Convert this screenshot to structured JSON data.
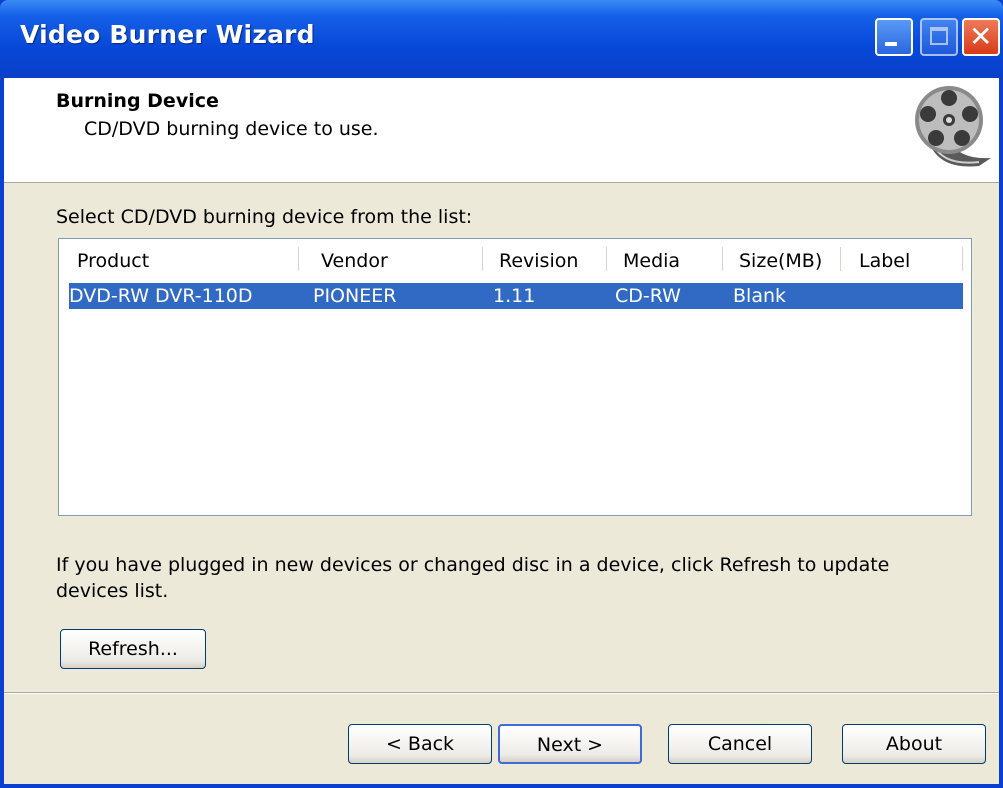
{
  "window": {
    "title": "Video Burner Wizard",
    "controls": [
      "minimize-icon",
      "maximize-icon",
      "close-icon"
    ]
  },
  "header": {
    "title": "Burning Device",
    "subtitle": "CD/DVD burning device to use."
  },
  "device_list": {
    "label": "Select CD/DVD burning device from the list:",
    "columns": [
      "Product",
      "Vendor",
      "Revision",
      "Media",
      "Size(MB)",
      "Label"
    ],
    "rows": [
      {
        "product": "DVD-RW  DVR-110D",
        "vendor": "PIONEER",
        "revision": "1.11",
        "media": "CD-RW",
        "size": "Blank",
        "label": "",
        "selected": true
      }
    ]
  },
  "info": "If you have plugged in new devices or changed disc in a device, click Refresh to update devices list.",
  "buttons": {
    "refresh": "Refresh...",
    "back": "< Back",
    "next": "Next >",
    "cancel": "Cancel",
    "about": "About"
  },
  "colors": {
    "title_bar": "#0a3fd0",
    "selection": "#316ac5",
    "dialog_bg": "#ece9d8"
  },
  "icons": {
    "header": "film-reel-icon"
  }
}
